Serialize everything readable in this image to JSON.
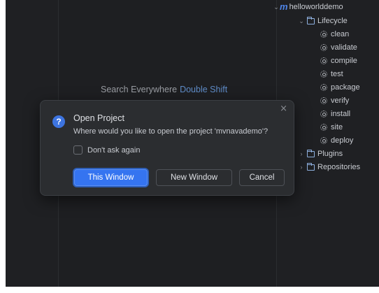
{
  "editor": {
    "search_hint": "Search Everywhere",
    "search_shortcut": "Double Shift"
  },
  "maven_tree": {
    "project": "helloworlddemo",
    "lifecycle": "Lifecycle",
    "goals": [
      "clean",
      "validate",
      "compile",
      "test",
      "package",
      "verify",
      "install",
      "site",
      "deploy"
    ],
    "plugins": "Plugins",
    "repositories": "Repositories"
  },
  "dialog": {
    "title": "Open Project",
    "message": "Where would you like to open the project 'mvnavademo'?",
    "checkbox_label": "Don't ask again",
    "checkbox_checked": false,
    "btn_this_window": "This Window",
    "btn_new_window": "New Window",
    "btn_cancel": "Cancel",
    "close_glyph": "×",
    "icon_glyph": "?"
  },
  "colors": {
    "accent": "#3574f0",
    "background": "#1e1f22",
    "dialog_bg": "#2b2d30"
  }
}
